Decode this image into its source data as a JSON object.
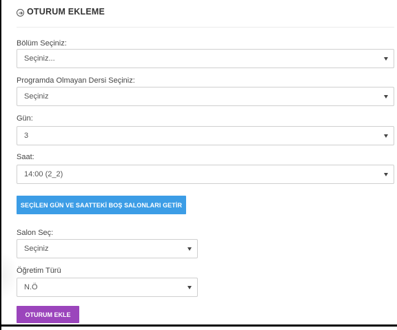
{
  "header": {
    "title": "OTURUM EKLEME",
    "icon": "arrow-right-circle-icon"
  },
  "fields": {
    "bolum": {
      "label": "Bölüm Seçiniz:",
      "value": "Seçiniz..."
    },
    "ders": {
      "label": "Programda Olmayan Dersi Seçiniz:",
      "value": "Seçiniz"
    },
    "gun": {
      "label": "Gün:",
      "value": "3"
    },
    "saat": {
      "label": "Saat:",
      "value": "14:00 (2_2)"
    },
    "salon": {
      "label": "Salon Seç:",
      "value": "Seçiniz"
    },
    "ogretim": {
      "label": "Öğretim Türü",
      "value": "N.Ö"
    }
  },
  "buttons": {
    "getir": "SEÇİLEN GÜN VE SAATTEKİ BOŞ SALONLARI GETİR",
    "ekle": "OTURUM EKLE"
  },
  "colors": {
    "primary_button": "#3c9de6",
    "submit_button": "#9b45bc"
  }
}
